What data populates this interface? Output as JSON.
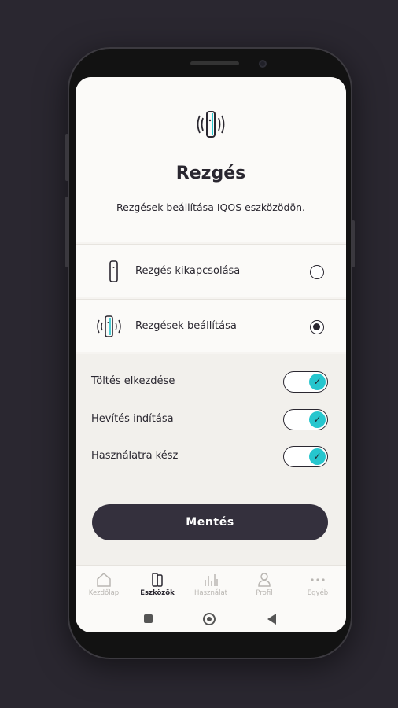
{
  "page": {
    "title": "Rezgés",
    "subtitle": "Rezgések beállítása IQOS eszközödön."
  },
  "options": [
    {
      "label": "Rezgés kikapcsolása",
      "icon": "device-icon",
      "selected": false
    },
    {
      "label": "Rezgések beállítása",
      "icon": "device-vibrate-icon",
      "selected": true
    }
  ],
  "settings": [
    {
      "label": "Töltés elkezdése",
      "enabled": true
    },
    {
      "label": "Hevítés indítása",
      "enabled": true
    },
    {
      "label": "Használatra kész",
      "enabled": true
    }
  ],
  "save_label": "Mentés",
  "tabs": [
    {
      "label": "Kezdőlap",
      "icon": "home-icon",
      "active": false
    },
    {
      "label": "Eszközök",
      "icon": "devices-icon",
      "active": true
    },
    {
      "label": "Használat",
      "icon": "usage-chart-icon",
      "active": false
    },
    {
      "label": "Profil",
      "icon": "profile-icon",
      "active": false
    },
    {
      "label": "Egyéb",
      "icon": "more-icon",
      "active": false
    }
  ],
  "colors": {
    "accent": "#26c6ce",
    "primary_dark": "#34303d",
    "background": "#f6f4f1"
  }
}
